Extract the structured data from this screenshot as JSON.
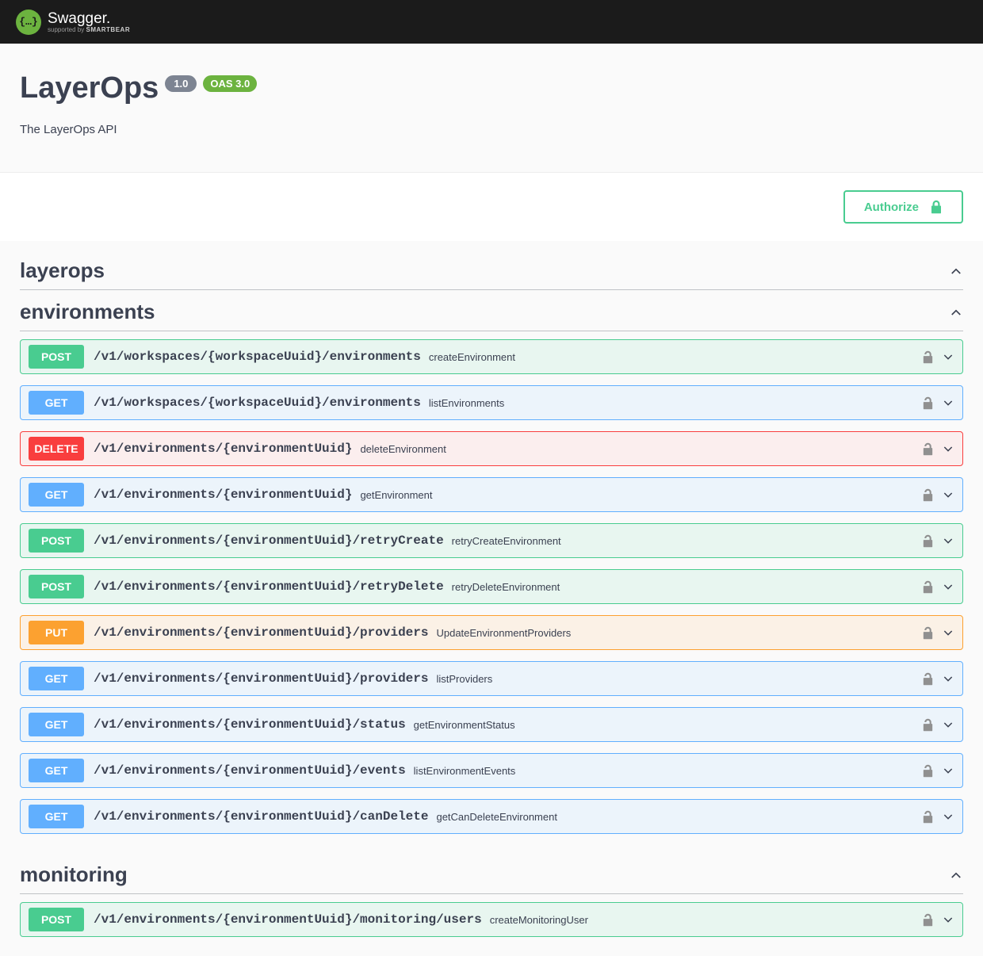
{
  "brand": {
    "name": "Swagger.",
    "sublabel_prefix": "supported by ",
    "sublabel_brand": "SMARTBEAR"
  },
  "api": {
    "title": "LayerOps",
    "version": "1.0",
    "oas": "OAS 3.0",
    "description": "The LayerOps API"
  },
  "authorize_label": "Authorize",
  "tags": [
    {
      "name": "layerops",
      "ops": []
    },
    {
      "name": "environments",
      "ops": [
        {
          "method": "POST",
          "path": "/v1/workspaces/{workspaceUuid}/environments",
          "summary": "createEnvironment"
        },
        {
          "method": "GET",
          "path": "/v1/workspaces/{workspaceUuid}/environments",
          "summary": "listEnvironments"
        },
        {
          "method": "DELETE",
          "path": "/v1/environments/{environmentUuid}",
          "summary": "deleteEnvironment"
        },
        {
          "method": "GET",
          "path": "/v1/environments/{environmentUuid}",
          "summary": "getEnvironment"
        },
        {
          "method": "POST",
          "path": "/v1/environments/{environmentUuid}/retryCreate",
          "summary": "retryCreateEnvironment"
        },
        {
          "method": "POST",
          "path": "/v1/environments/{environmentUuid}/retryDelete",
          "summary": "retryDeleteEnvironment"
        },
        {
          "method": "PUT",
          "path": "/v1/environments/{environmentUuid}/providers",
          "summary": "UpdateEnvironmentProviders"
        },
        {
          "method": "GET",
          "path": "/v1/environments/{environmentUuid}/providers",
          "summary": "listProviders"
        },
        {
          "method": "GET",
          "path": "/v1/environments/{environmentUuid}/status",
          "summary": "getEnvironmentStatus"
        },
        {
          "method": "GET",
          "path": "/v1/environments/{environmentUuid}/events",
          "summary": "listEnvironmentEvents"
        },
        {
          "method": "GET",
          "path": "/v1/environments/{environmentUuid}/canDelete",
          "summary": "getCanDeleteEnvironment"
        }
      ]
    },
    {
      "name": "monitoring",
      "ops": [
        {
          "method": "POST",
          "path": "/v1/environments/{environmentUuid}/monitoring/users",
          "summary": "createMonitoringUser"
        }
      ]
    }
  ]
}
